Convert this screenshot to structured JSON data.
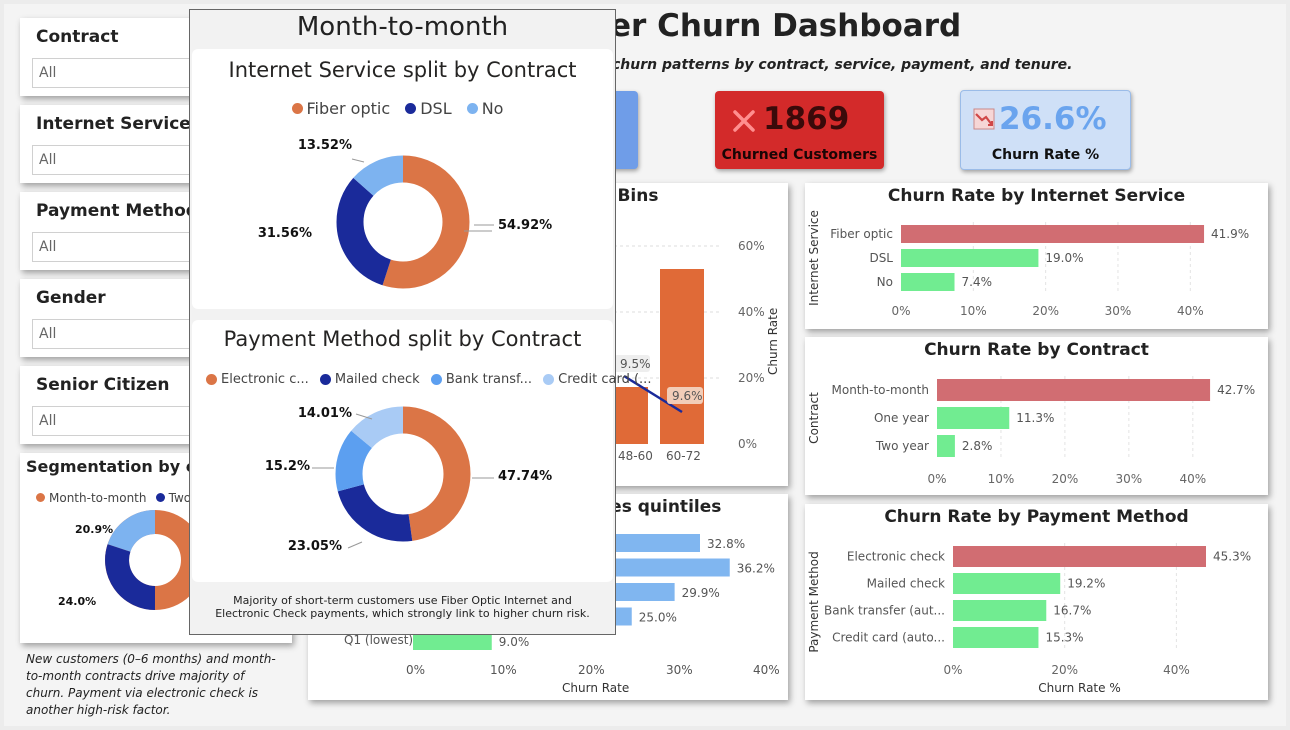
{
  "header": {
    "title": "er Churn Dashboard",
    "subtitle": "churn patterns by contract, service, payment, and tenure."
  },
  "kpis": {
    "churned": {
      "value": "1869",
      "label": "Churned Customers",
      "icon": "x-icon",
      "bg": "#d32a2a"
    },
    "rate": {
      "value": "26.6%",
      "label": "Churn Rate %",
      "icon": "trend-down-chart-icon",
      "bg": "#cfe0f7"
    }
  },
  "slicers": [
    {
      "title": "Contract",
      "value": "All"
    },
    {
      "title": "Internet Service",
      "value": "All"
    },
    {
      "title": "Payment Method",
      "value": "All"
    },
    {
      "title": "Gender",
      "value": "All"
    },
    {
      "title": "Senior Citizen",
      "value": "All"
    }
  ],
  "segmentation": {
    "title": "Segmentation by co",
    "legend": [
      "Month-to-month",
      "Two y"
    ],
    "labels": [
      "20.9%",
      "24.0%"
    ]
  },
  "note": "New customers (0–6 months) and month-to-month contracts drive majority of churn. Payment via electronic check is another high-risk factor.",
  "tenure": {
    "title": "e Bins",
    "y2label": "Churn Rate",
    "y2ticks": [
      "60%",
      "40%",
      "20%",
      "0%"
    ],
    "xcats": [
      "48-60",
      "60-72"
    ],
    "point_labels": [
      "9.5%",
      "9.6%"
    ]
  },
  "charges": {
    "title": "ges quintiles",
    "xlabel": "Churn Rate",
    "xticks": [
      "0%",
      "10%",
      "20%",
      "30%",
      "40%"
    ],
    "q1_label": "Q1 (lowest)"
  },
  "popup": {
    "title": "Month-to-month",
    "internet_title": "Internet Service split by Contract",
    "internet_legend": [
      "Fiber optic",
      "DSL",
      "No"
    ],
    "payment_title": "Payment Method split by Contract",
    "payment_legend": [
      "Electronic c...",
      "Mailed check",
      "Bank transf...",
      "Credit card (..."
    ],
    "footnote_1": "Majority of short-term customers use Fiber Optic Internet and",
    "footnote_2": "Electronic Check payments, which strongly link to higher churn risk."
  },
  "colors": {
    "orange": "#db7546",
    "navy": "#1a2a9a",
    "lightblue": "#7db3f0",
    "palestblue": "#a9cbf5",
    "bar_red": "#d16d72",
    "bar_green": "#71ec91",
    "bar_blue": "#80b6f0",
    "bar_orange": "#e06a37"
  },
  "chart_data": [
    {
      "type": "bar",
      "orientation": "horizontal",
      "title": "Churn Rate by Internet Service",
      "ylabel": "Internet Service",
      "xlabel": "",
      "categories": [
        "Fiber optic",
        "DSL",
        "No"
      ],
      "values": [
        41.9,
        19.0,
        7.4
      ],
      "value_labels": [
        "41.9%",
        "19.0%",
        "7.4%"
      ],
      "xticks": [
        "0%",
        "10%",
        "20%",
        "30%",
        "40%"
      ],
      "xlim": [
        0,
        43
      ]
    },
    {
      "type": "bar",
      "orientation": "horizontal",
      "title": "Churn Rate by Contract",
      "ylabel": "Contract",
      "xlabel": "",
      "categories": [
        "Month-to-month",
        "One year",
        "Two year"
      ],
      "values": [
        42.7,
        11.3,
        2.8
      ],
      "value_labels": [
        "42.7%",
        "11.3%",
        "2.8%"
      ],
      "xticks": [
        "0%",
        "10%",
        "20%",
        "30%",
        "40%"
      ],
      "xlim": [
        0,
        43
      ]
    },
    {
      "type": "bar",
      "orientation": "horizontal",
      "title": "Churn Rate by Payment Method",
      "ylabel": "Payment Method",
      "xlabel": "Churn Rate %",
      "categories": [
        "Electronic check",
        "Mailed check",
        "Bank transfer (aut...",
        "Credit card (auto..."
      ],
      "values": [
        45.3,
        19.2,
        16.7,
        15.3
      ],
      "value_labels": [
        "45.3%",
        "19.2%",
        "16.7%",
        "15.3%"
      ],
      "xticks": [
        "0%",
        "20%",
        "40%"
      ],
      "xlim": [
        0,
        45.3
      ]
    },
    {
      "type": "pie",
      "title": "Internet Service split by Contract",
      "labels": [
        "Fiber optic",
        "DSL",
        "No"
      ],
      "values": [
        54.92,
        31.56,
        13.52
      ],
      "value_labels": [
        "54.92%",
        "31.56%",
        "13.52%"
      ]
    },
    {
      "type": "pie",
      "title": "Payment Method split by Contract",
      "labels": [
        "Electronic c...",
        "Mailed check",
        "Bank transf...",
        "Credit card (..."
      ],
      "values": [
        47.74,
        23.05,
        15.2,
        14.01
      ],
      "value_labels": [
        "47.74%",
        "23.05%",
        "15.2%",
        "14.01%"
      ]
    },
    {
      "type": "bar",
      "orientation": "horizontal",
      "title": "ges quintiles",
      "xlabel": "Churn Rate",
      "categories": [
        "",
        "",
        "",
        "",
        "Q1 (lowest)"
      ],
      "values": [
        32.8,
        36.2,
        29.9,
        25.0,
        9.0
      ],
      "value_labels": [
        "32.8%",
        "36.2%",
        "29.9%",
        "25.0%",
        "9.0%"
      ],
      "xlim": [
        0,
        40
      ]
    }
  ]
}
